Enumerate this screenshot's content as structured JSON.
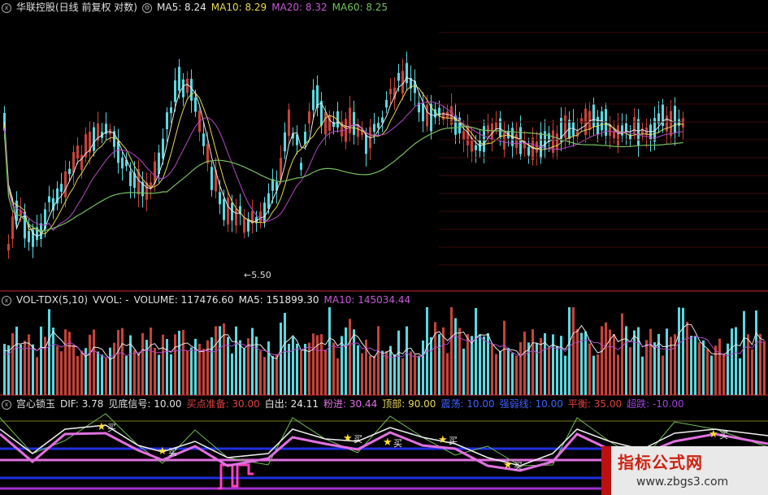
{
  "price_header": {
    "title": "华联控股(日线 前复权 对数)",
    "ma5": "MA5: 8.24",
    "ma10": "MA10: 8.29",
    "ma20": "MA20: 8.32",
    "ma60": "MA60: 8.25"
  },
  "low_marker": "←5.50",
  "volume_header": {
    "name": "VOL-TDX(5,10)",
    "wol": "VVOL: -",
    "volume": "VOLUME: 117476.60",
    "ma5": "MA5: 151899.30",
    "ma10": "MA10: 145034.44"
  },
  "indicator_header": {
    "name": "宫心锁玉",
    "dif": "DIF: 3.78",
    "jiandi": "见底信号: 10.00",
    "maidian": "买点准备: 30.00",
    "baichu": "白出: 24.11",
    "fenjin": "粉进: 30.44",
    "dingbu": "顶部: 90.00",
    "zhendang": "震荡: 10.00",
    "qiangshi": "强弱线: 10.00",
    "pinghen": "平衡: 35.00",
    "chaodie": "超跌: -10.00"
  },
  "buy_label": "买",
  "watermark": {
    "title": "指标公式网",
    "url": "www.zbgs3.com"
  },
  "colors": {
    "up": "#c8423a",
    "down": "#5ad8e0",
    "ma5": "#e8e8e8",
    "ma10": "#e8d85a",
    "ma20": "#b848c8",
    "ma60": "#78c060",
    "separator": "#8a1a1a"
  }
}
